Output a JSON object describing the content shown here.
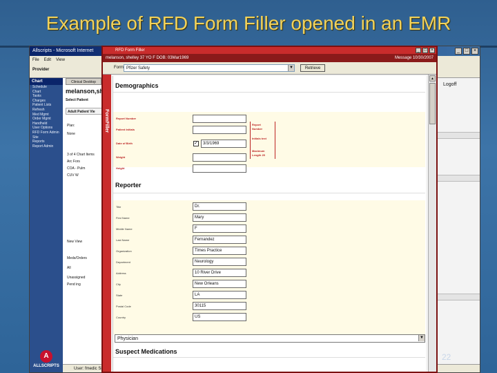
{
  "slide": {
    "title": "Example of RFD Form Filler opened in an EMR",
    "page_number": "22"
  },
  "emr": {
    "title": "Allscripts - Microsoft Internet",
    "menu": [
      "File",
      "Edit",
      "View"
    ],
    "provider_label": "Provider",
    "logoff": "Logoff",
    "sidebar_header": "Chart",
    "sidebar_items": [
      "Schedule",
      "Chart",
      "Tasks",
      "Charges",
      "Patient Lists",
      "Refresh",
      "Med Mgmt",
      "Order Mgmt",
      "Handheld",
      "User Options",
      "RFD Form Admin",
      "Site",
      "Reports",
      "Report Admin"
    ],
    "content_tab": "Clinical Desktop",
    "patient_name": "melanson,she",
    "select_patient": "Select Patient",
    "adult_view": "Adult Patient Vie",
    "list_items": [
      "Plan:",
      "None",
      "3 of 4 Chart Items",
      "Arc Fors",
      "COA - Pulm",
      "CUV    W",
      "New  View",
      "Meds/Orders",
      "All",
      "Unassigned",
      "Pend ing"
    ],
    "status": "User: fmedic  Site: KS",
    "logo_text": "ALLSCRIPTS",
    "logo_mark": "A"
  },
  "filler": {
    "title": "RFD Form Filler",
    "patient_bar": "melanson, shelley 37 YO F DOB: 03Mar1969",
    "message": "Message 10/30/2007",
    "form_label": "Form:",
    "form_value": "Pfizer Safety",
    "retrieve_label": "Retrieve",
    "side_label": "FormFiller",
    "demographics": {
      "heading": "Demographics",
      "fields": [
        {
          "label": "Report Number",
          "value": ""
        },
        {
          "label": "Patient Initials",
          "value": ""
        },
        {
          "label": "Date of Birth",
          "value": "3/3/1969"
        },
        {
          "label": "Weight",
          "value": ""
        },
        {
          "label": "Height",
          "value": ""
        }
      ],
      "hints": [
        "Report",
        "Number",
        "Initials text",
        "Maximum",
        "Length 25"
      ]
    },
    "reporter": {
      "heading": "Reporter",
      "fields": [
        {
          "label": "Title",
          "value": "Dr."
        },
        {
          "label": "First Name",
          "value": "Mary"
        },
        {
          "label": "Middle Name",
          "value": "F"
        },
        {
          "label": "Last Name",
          "value": "Fernandez"
        },
        {
          "label": "Organization",
          "value": "Times Practice"
        },
        {
          "label": "Department",
          "value": "Neurology"
        },
        {
          "label": "Address",
          "value": "10 River Drive"
        },
        {
          "label": "City",
          "value": "New Orleans"
        },
        {
          "label": "State",
          "value": "LA"
        },
        {
          "label": "Postal Code",
          "value": "30115"
        },
        {
          "label": "Country",
          "value": "US"
        }
      ],
      "role_dropdown": "Physician"
    },
    "suspect": {
      "heading": "Suspect Medications"
    }
  }
}
